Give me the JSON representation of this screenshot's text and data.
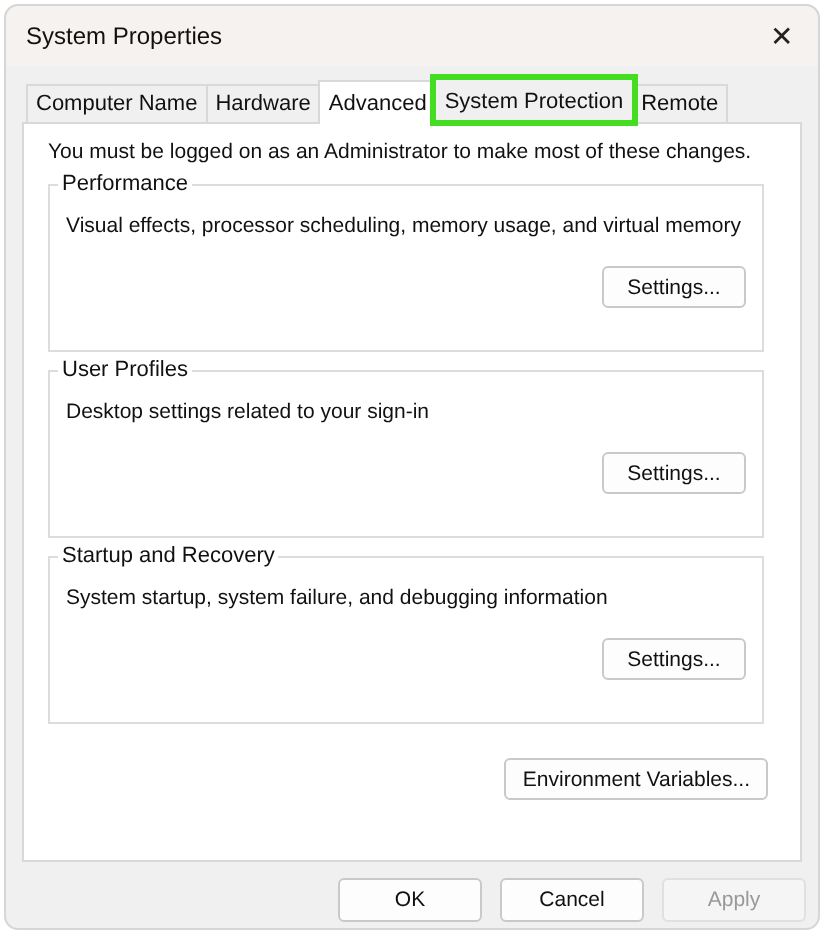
{
  "window": {
    "title": "System Properties",
    "close": "✕"
  },
  "tabs": [
    {
      "label": "Computer Name",
      "selected": false,
      "highlighted": false
    },
    {
      "label": "Hardware",
      "selected": false,
      "highlighted": false
    },
    {
      "label": "Advanced",
      "selected": true,
      "highlighted": false
    },
    {
      "label": "System Protection",
      "selected": false,
      "highlighted": true
    },
    {
      "label": "Remote",
      "selected": false,
      "highlighted": false
    }
  ],
  "notice": "You must be logged on as an Administrator to make most of these changes.",
  "groups": [
    {
      "title": "Performance",
      "description": "Visual effects, processor scheduling, memory usage, and virtual memory",
      "button": "Settings..."
    },
    {
      "title": "User Profiles",
      "description": "Desktop settings related to your sign-in",
      "button": "Settings..."
    },
    {
      "title": "Startup and Recovery",
      "description": "System startup, system failure, and debugging information",
      "button": "Settings..."
    }
  ],
  "environment_button": "Environment Variables...",
  "buttons": [
    {
      "label": "OK",
      "disabled": false
    },
    {
      "label": "Cancel",
      "disabled": false
    },
    {
      "label": "Apply",
      "disabled": true
    }
  ]
}
